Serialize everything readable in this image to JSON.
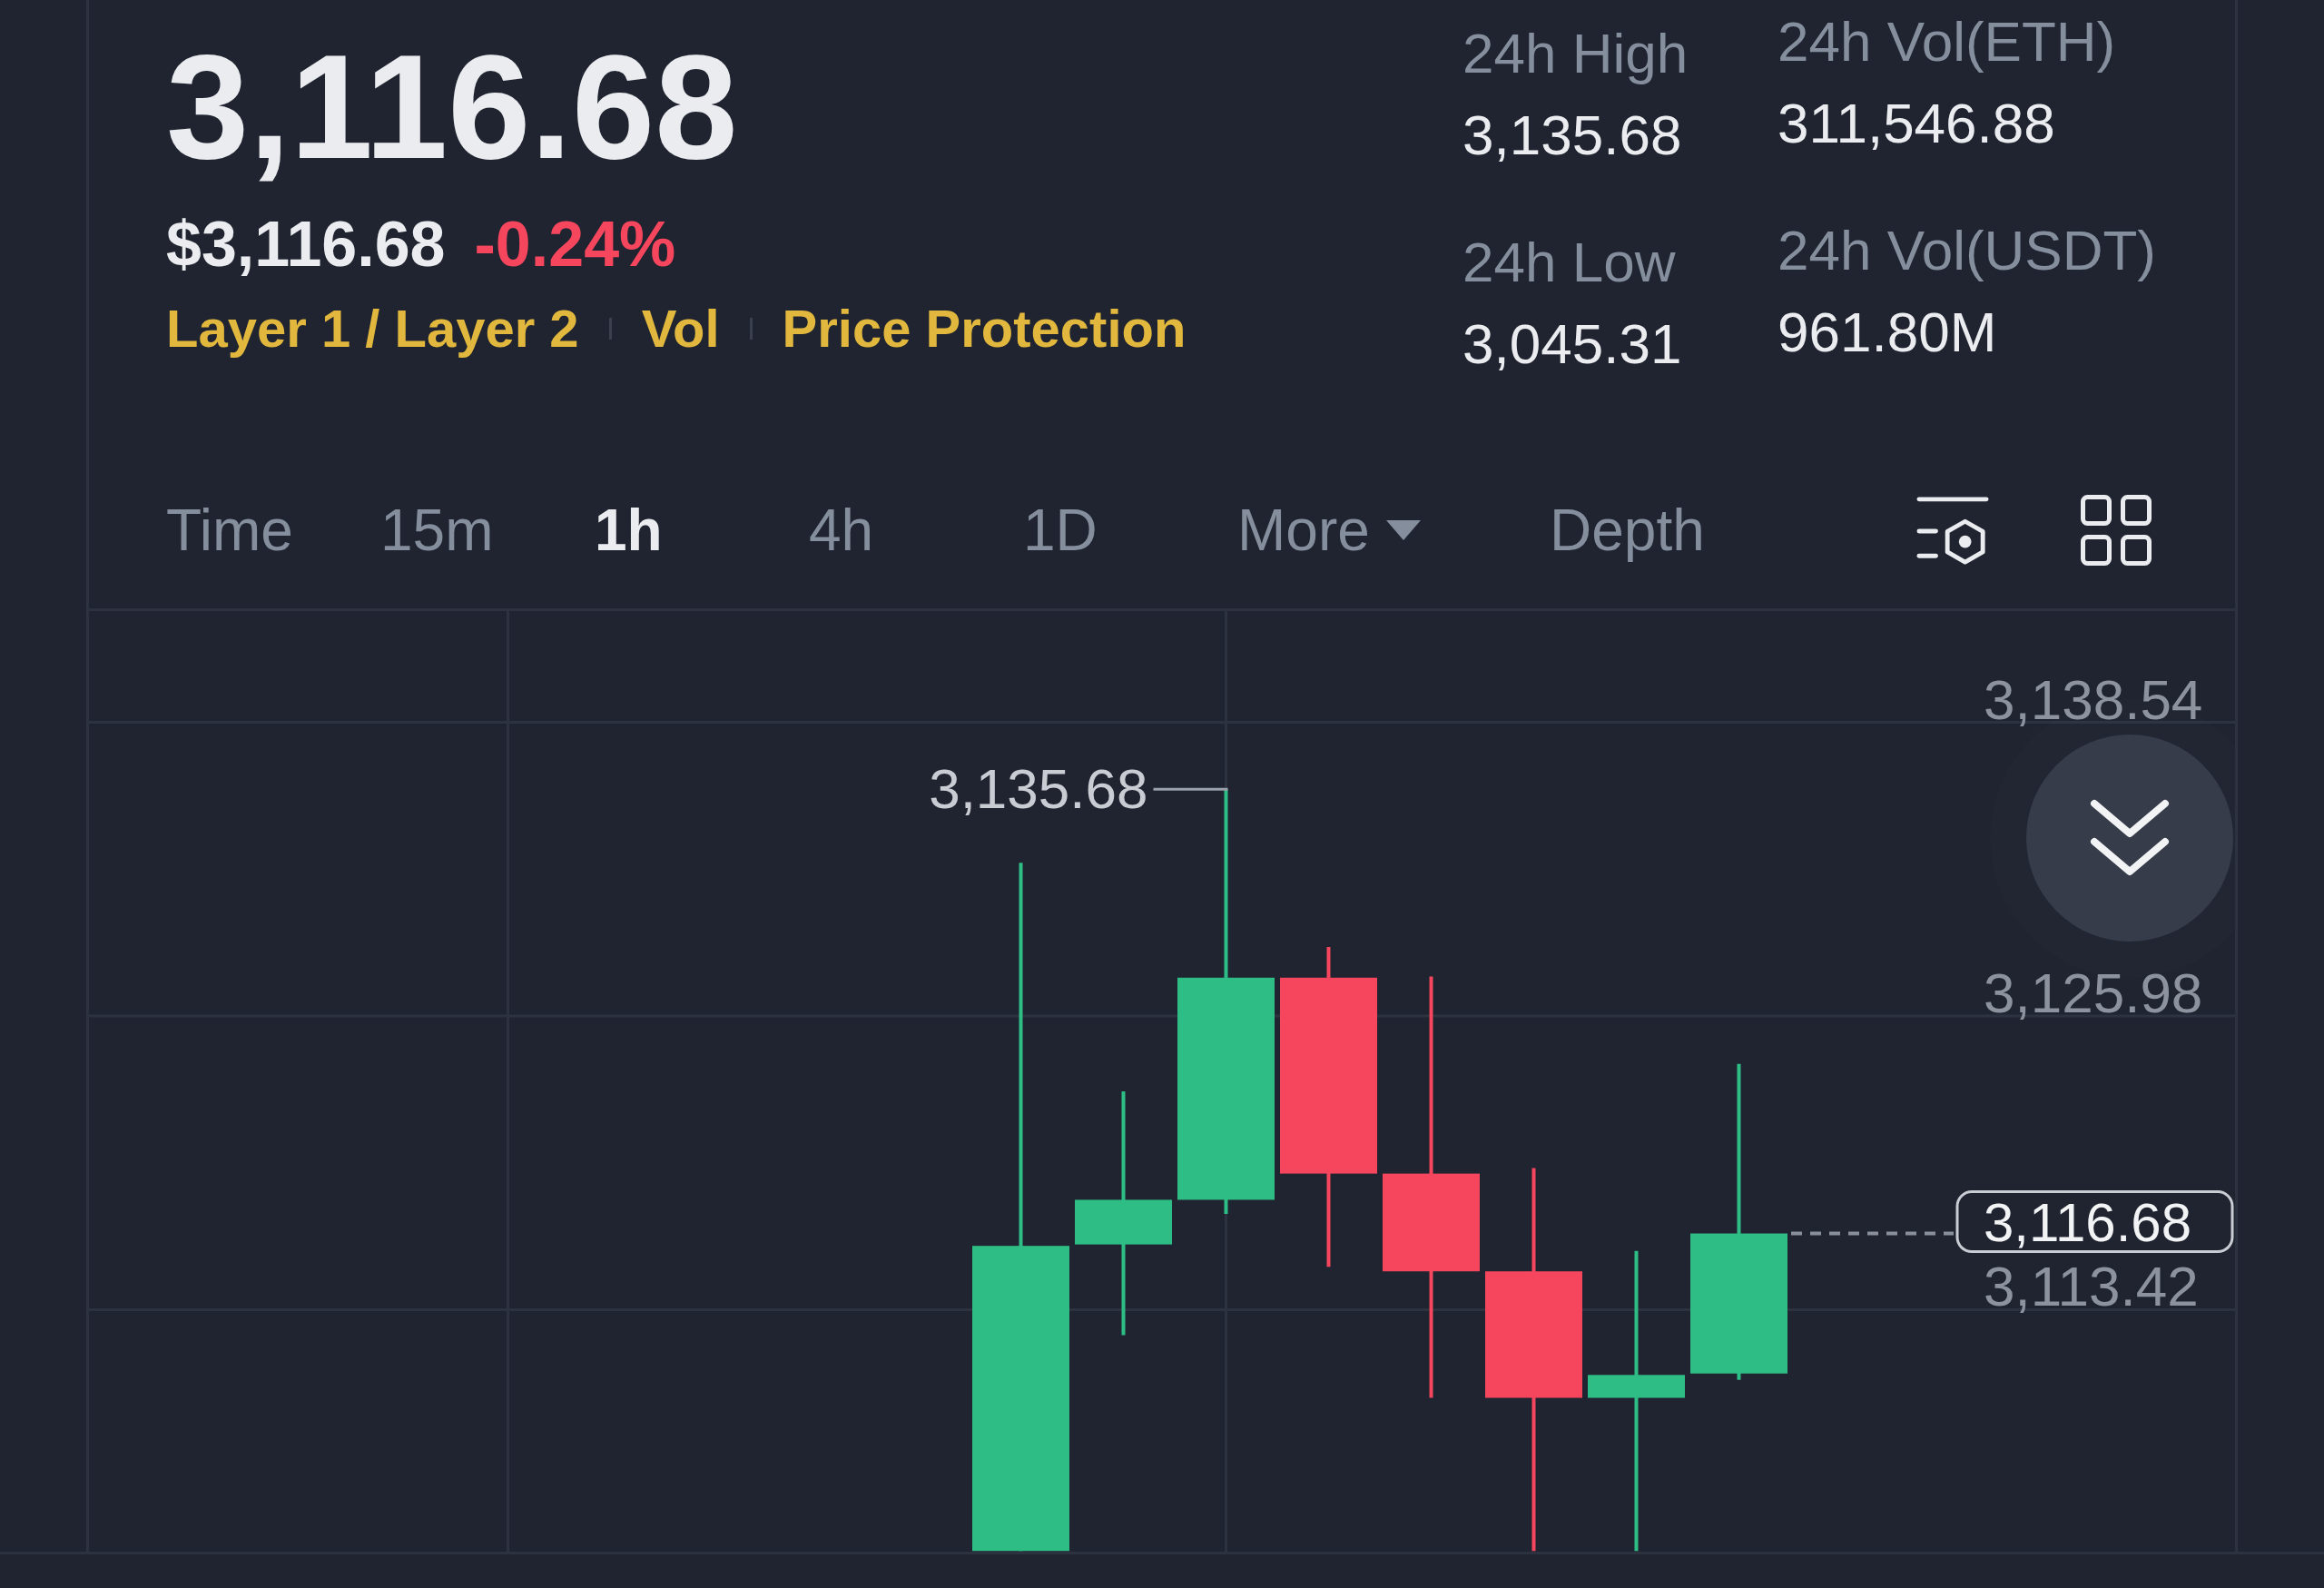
{
  "price": {
    "last": "3,116.68",
    "fiat": "$3,116.68",
    "change": "-0.24%",
    "down": true
  },
  "tags": [
    "Layer 1 / Layer 2",
    "Vol",
    "Price Protection"
  ],
  "stat_columns": [
    {
      "items": [
        {
          "label": "24h High",
          "value": "3,135.68"
        },
        {
          "label": "24h Low",
          "value": "3,045.31"
        }
      ]
    },
    {
      "items": [
        {
          "label": "24h Vol(ETH)",
          "value": "311,546.88"
        },
        {
          "label": "24h Vol(USDT)",
          "value": "961.80M"
        }
      ]
    }
  ],
  "tabs": [
    {
      "label": "Time",
      "kind": "option",
      "selected": false
    },
    {
      "label": "15m",
      "kind": "option",
      "selected": false
    },
    {
      "label": "1h",
      "kind": "option",
      "selected": true
    },
    {
      "label": "4h",
      "kind": "option",
      "selected": false
    },
    {
      "label": "1D",
      "kind": "option",
      "selected": false
    },
    {
      "label": "More",
      "kind": "dropdown",
      "selected": false
    },
    {
      "label": "Depth",
      "kind": "option",
      "selected": false
    }
  ],
  "chart": {
    "axis_labels": [
      "3,138.54",
      "3,125.98",
      "3,113.42"
    ],
    "high_label": "3,135.68",
    "price_tag": "3,116.68"
  }
}
